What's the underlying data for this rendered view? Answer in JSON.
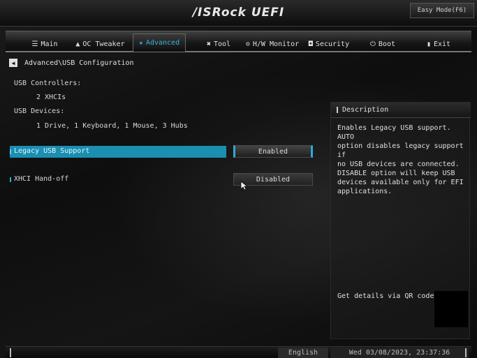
{
  "header": {
    "logo": "/ISRock UEFI",
    "easy_mode_label": "Easy Mode(F6)"
  },
  "tabs": [
    {
      "label": "Main",
      "icon": "list-icon",
      "glyph": "☰"
    },
    {
      "label": "OC Tweaker",
      "icon": "rocket-icon",
      "glyph": "▲"
    },
    {
      "label": "Advanced",
      "icon": "star-icon",
      "glyph": "★",
      "active": true
    },
    {
      "label": "Tool",
      "icon": "tools-icon",
      "glyph": "✖"
    },
    {
      "label": "H/W Monitor",
      "icon": "monitor-icon",
      "glyph": "⊙"
    },
    {
      "label": "Security",
      "icon": "shield-icon",
      "glyph": "◘"
    },
    {
      "label": "Boot",
      "icon": "power-icon",
      "glyph": "⏻"
    },
    {
      "label": "Exit",
      "icon": "exit-icon",
      "glyph": "▮"
    }
  ],
  "breadcrumb": {
    "back_glyph": "◀",
    "path": "Advanced\\USB Configuration"
  },
  "info": {
    "usb_controllers_label": "USB Controllers:",
    "usb_controllers_value": "2 XHCIs",
    "usb_devices_label": "USB Devices:",
    "usb_devices_value": "1 Drive, 1 Keyboard, 1 Mouse, 3 Hubs"
  },
  "settings": [
    {
      "label": "Legacy USB Support",
      "value": "Enabled",
      "selected": true
    },
    {
      "label": "XHCI Hand-off",
      "value": "Disabled",
      "selected": false
    }
  ],
  "description": {
    "title": "Description",
    "text": "Enables Legacy USB support. AUTO\noption disables legacy support if\nno USB devices are connected.\nDISABLE option will keep USB\ndevices available only for EFI\napplications.",
    "qr_label": "Get details via QR code"
  },
  "footer": {
    "language": "English",
    "datetime": "Wed 03/08/2023, 23:37:36"
  },
  "colors": {
    "accent": "#1a8fb2",
    "accent_text": "#32b5e0",
    "background": "#0e0e0e"
  }
}
